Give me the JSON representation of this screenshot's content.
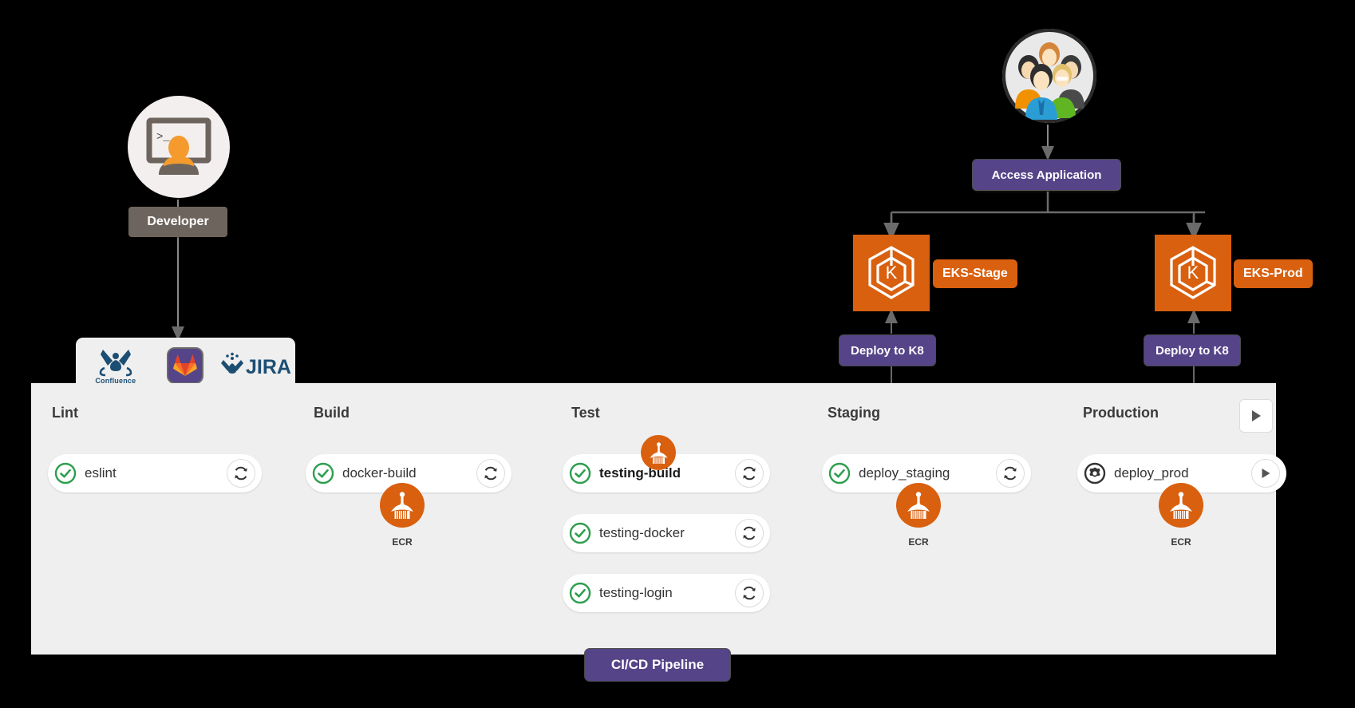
{
  "diagram": {
    "title": "CI/CD Pipeline",
    "background": "#000000",
    "panel_bg": "#efefef"
  },
  "colors": {
    "aws_orange": "#d9600f",
    "purple": "#554488",
    "gray_label": "#6d645d",
    "success_green": "#2e9e4f",
    "panel": "#efefef"
  },
  "developer": {
    "label": "Developer",
    "icon": "developer-terminal-icon"
  },
  "tools": {
    "items": [
      {
        "name": "confluence",
        "icon": "confluence-logo-icon",
        "caption": "Confluence"
      },
      {
        "name": "gitlab",
        "icon": "gitlab-logo-icon",
        "caption": ""
      },
      {
        "name": "jira",
        "icon": "jira-logo-icon",
        "caption": "JIRA"
      }
    ]
  },
  "users": {
    "icon": "users-group-icon",
    "access_label": "Access Application"
  },
  "clusters": [
    {
      "id": "stage",
      "icon": "kubernetes-hexagon-icon",
      "badge": "EKS-Stage",
      "deploy_label": "Deploy to K8"
    },
    {
      "id": "prod",
      "icon": "kubernetes-hexagon-icon",
      "badge": "EKS-Prod",
      "deploy_label": "Deploy to K8"
    }
  ],
  "pipeline": {
    "play_button_icon": "play-icon",
    "stages": [
      {
        "name": "Lint",
        "jobs": [
          {
            "label": "eslint",
            "status": "success",
            "status_icon": "check-circle-icon",
            "action_icon": "retry-icon",
            "bold": false,
            "artifact": null
          }
        ]
      },
      {
        "name": "Build",
        "jobs": [
          {
            "label": "docker-build",
            "status": "success",
            "status_icon": "check-circle-icon",
            "action_icon": "retry-icon",
            "bold": false,
            "artifact": "ECR"
          }
        ]
      },
      {
        "name": "Test",
        "jobs": [
          {
            "label": "testing-build",
            "status": "success",
            "status_icon": "check-circle-icon",
            "action_icon": "retry-icon",
            "bold": true,
            "artifact": ""
          },
          {
            "label": "testing-docker",
            "status": "success",
            "status_icon": "check-circle-icon",
            "action_icon": "retry-icon",
            "bold": false,
            "artifact": null
          },
          {
            "label": "testing-login",
            "status": "success",
            "status_icon": "check-circle-icon",
            "action_icon": "retry-icon",
            "bold": false,
            "artifact": null
          }
        ]
      },
      {
        "name": "Staging",
        "jobs": [
          {
            "label": "deploy_staging",
            "status": "success",
            "status_icon": "check-circle-icon",
            "action_icon": "retry-icon",
            "bold": false,
            "artifact": "ECR"
          }
        ]
      },
      {
        "name": "Production",
        "jobs": [
          {
            "label": "deploy_prod",
            "status": "manual",
            "status_icon": "gear-circle-icon",
            "action_icon": "play-icon",
            "bold": false,
            "artifact": "ECR"
          }
        ]
      }
    ]
  }
}
